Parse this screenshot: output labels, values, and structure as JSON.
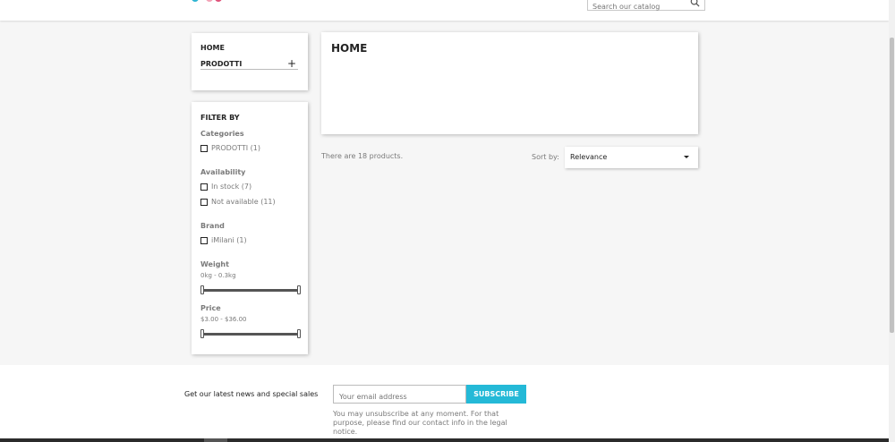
{
  "search": {
    "placeholder": "Search our catalog",
    "icon": "search-icon"
  },
  "categories": {
    "home": "HOME",
    "prodotti": "PRODOTTI",
    "expand_symbol": "+"
  },
  "filters": {
    "title": "FILTER BY",
    "categories_label": "Categories",
    "categories_options": [
      "PRODOTTI (1)"
    ],
    "availability_label": "Availability",
    "availability_options": [
      "In stock (7)",
      "Not available (11)"
    ],
    "brand_label": "Brand",
    "brand_options": [
      "iMilani (1)"
    ],
    "weight_label": "Weight",
    "weight_range": "0kg - 0.3kg",
    "price_label": "Price",
    "price_range": "$3.00 - $36.00"
  },
  "main": {
    "title": "HOME",
    "product_count": "There are 18 products.",
    "sort_label": "Sort by:",
    "sort_value": "Relevance"
  },
  "newsletter": {
    "text": "Get our latest news and special sales",
    "email_placeholder": "Your email address",
    "subscribe_label": "SUBSCRIBE",
    "note": "You may unsubscribe at any moment. For that purpose, please find our contact info in the legal notice."
  },
  "colors": {
    "accent": "#24b9d7",
    "logo_a": "#2fb5d2",
    "logo_b": "#e0527a"
  }
}
